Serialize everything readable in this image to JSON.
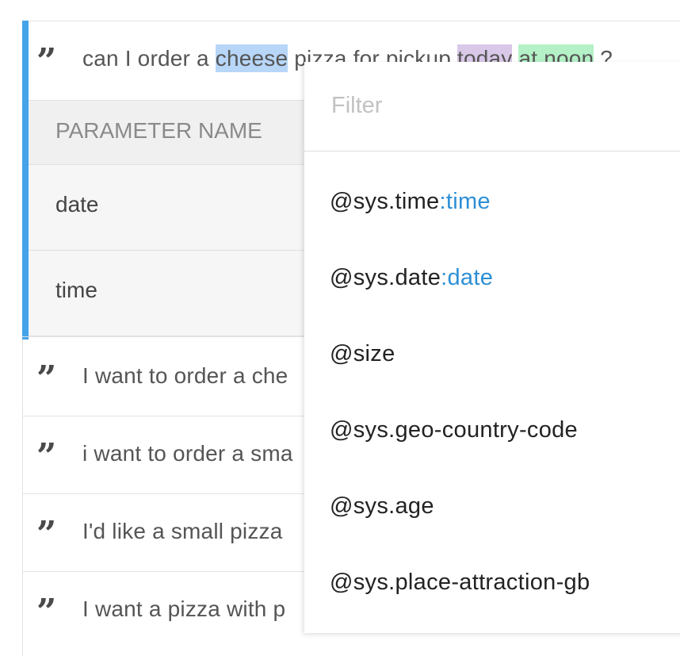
{
  "active_example": {
    "parts": [
      {
        "text": "can I order a ",
        "hl": ""
      },
      {
        "text": "cheese",
        "hl": "blue"
      },
      {
        "text": " pizza for pickup ",
        "hl": ""
      },
      {
        "text": "today",
        "hl": "purple"
      },
      {
        "text": " ",
        "hl": ""
      },
      {
        "text": "at noon",
        "hl": "green"
      },
      {
        "text": " ?",
        "hl": ""
      }
    ]
  },
  "params_table": {
    "header": "PARAMETER NAME",
    "rows": [
      "date",
      "time"
    ]
  },
  "examples": [
    "I want to order a che",
    "i want to order a sma",
    "I'd like a small pizza",
    "I want a pizza with p"
  ],
  "dropdown": {
    "filter_placeholder": "Filter",
    "options": [
      {
        "entity": "@sys.time",
        "type": ":time"
      },
      {
        "entity": "@sys.date",
        "type": ":date"
      },
      {
        "entity": "@size",
        "type": ""
      },
      {
        "entity": "@sys.geo-country-code",
        "type": ""
      },
      {
        "entity": "@sys.age",
        "type": ""
      },
      {
        "entity": "@sys.place-attraction-gb",
        "type": ""
      }
    ]
  },
  "colors": {
    "accent_bar": "#45a3ea",
    "highlight_blue": "#b7d6f8",
    "highlight_purple": "#d9c8e8",
    "highlight_green": "#b4f1c6",
    "entity_type": "#2d8fd5"
  }
}
